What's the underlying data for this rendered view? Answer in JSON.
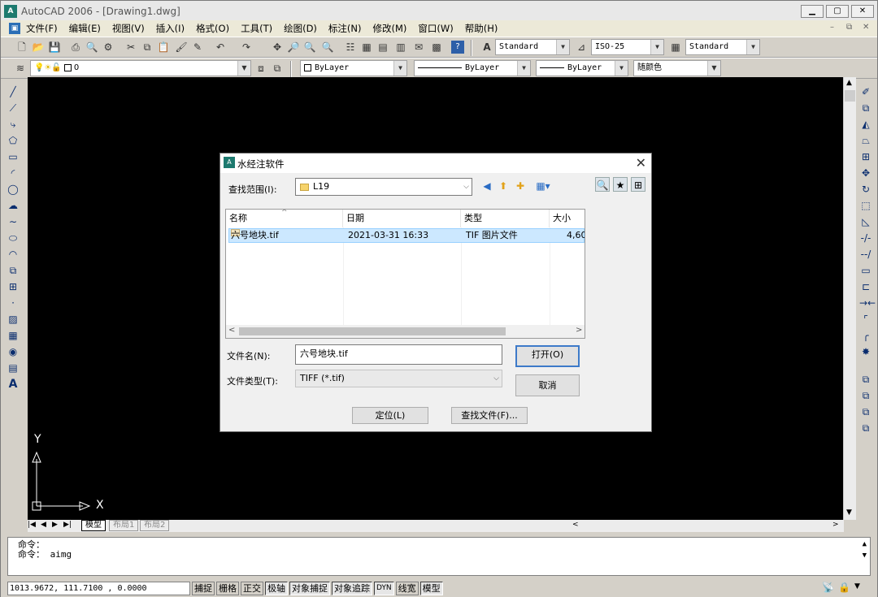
{
  "app": {
    "title": "AutoCAD 2006 - [Drawing1.dwg]",
    "icon_text": "A"
  },
  "menu": [
    "文件(F)",
    "编辑(E)",
    "视图(V)",
    "插入(I)",
    "格式(O)",
    "工具(T)",
    "绘图(D)",
    "标注(N)",
    "修改(M)",
    "窗口(W)",
    "帮助(H)"
  ],
  "toolbar": {
    "text_style": "Standard",
    "dim_style": "ISO-25",
    "table_style": "Standard",
    "layer": "0",
    "color": "ByLayer",
    "linetype": "ByLayer",
    "lineweight": "ByLayer",
    "plot_style": "随颜色"
  },
  "ucs": {
    "x_label": "X",
    "y_label": "Y"
  },
  "layout_tabs": [
    "模型",
    "布局1",
    "布局2"
  ],
  "command": {
    "line1": "命令：",
    "line2": "命令： aimg"
  },
  "status": {
    "coordinates": "1013.9672, 111.7100 , 0.0000",
    "buttons": [
      "捕捉",
      "栅格",
      "正交",
      "极轴",
      "对象捕捉",
      "对象追踪",
      "DYN",
      "线宽",
      "模型"
    ]
  },
  "dialog": {
    "title": "水经注软件",
    "look_in_label": "查找范围(I):",
    "look_in_value": "L19",
    "columns": [
      "名称",
      "日期",
      "类型",
      "大小"
    ],
    "files": [
      {
        "name": "六号地块.tif",
        "date": "2021-03-31 16:33",
        "type": "TIF 图片文件",
        "size": "4,60"
      }
    ],
    "filename_label": "文件名(N):",
    "filename_value": "六号地块.tif",
    "filetype_label": "文件类型(T):",
    "filetype_value": "TIFF (*.tif)",
    "open_button": "打开(O)",
    "cancel_button": "取消",
    "locate_button": "定位(L)",
    "find_button": "查找文件(F)..."
  }
}
